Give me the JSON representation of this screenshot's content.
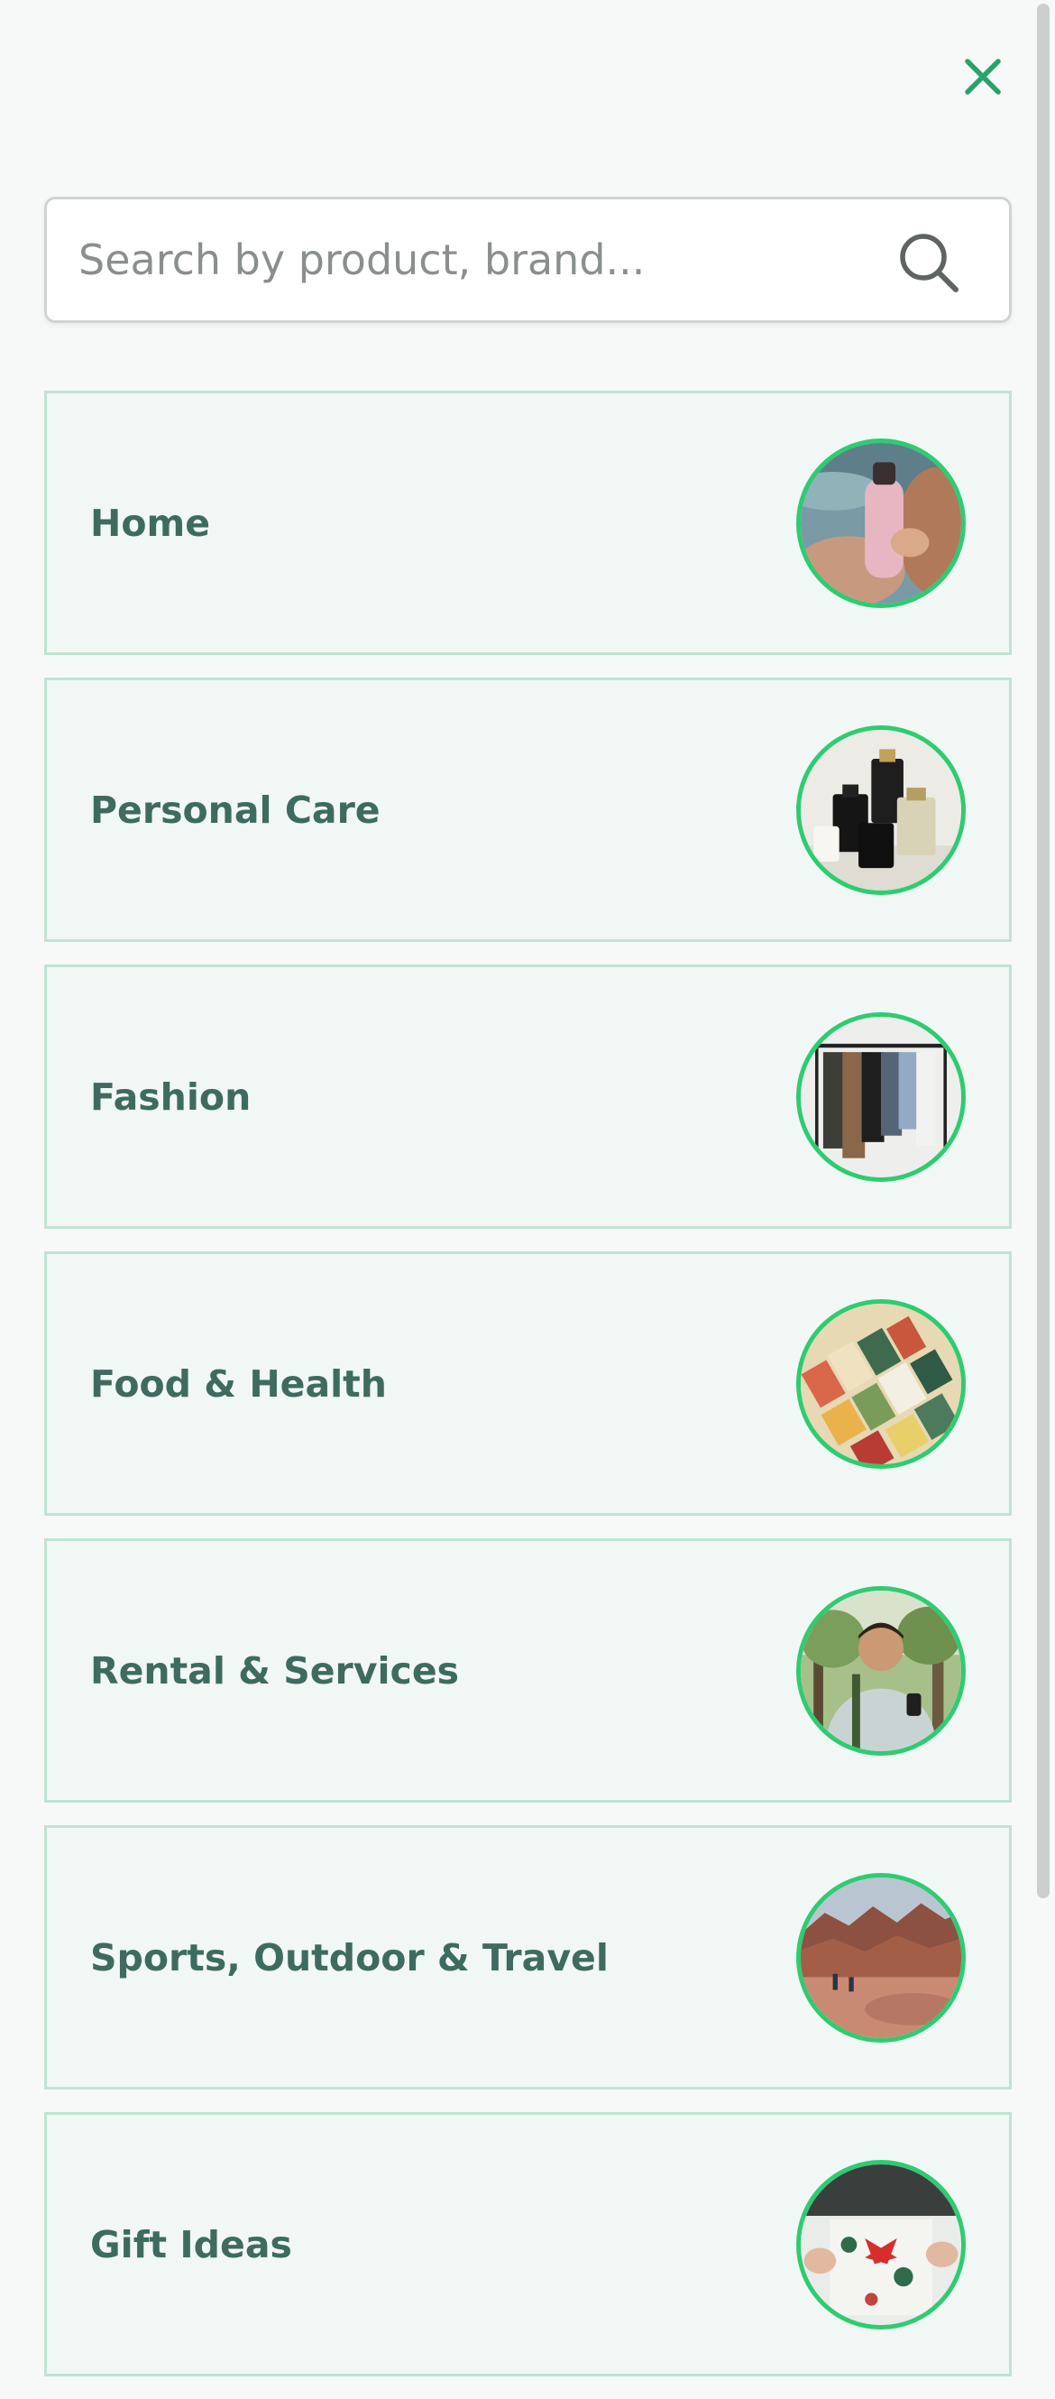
{
  "search": {
    "placeholder": "Search by product, brand..."
  },
  "categories": [
    {
      "label": "Home",
      "image": "pink-water-bottle-photo"
    },
    {
      "label": "Personal Care",
      "image": "perfume-bottles-photo"
    },
    {
      "label": "Fashion",
      "image": "clothing-rack-photo"
    },
    {
      "label": "Food & Health",
      "image": "food-boxes-photo"
    },
    {
      "label": "Rental & Services",
      "image": "man-with-phone-photo"
    },
    {
      "label": "Sports, Outdoor & Travel",
      "image": "canyon-hikers-photo"
    },
    {
      "label": "Gift Ideas",
      "image": "gift-wrapping-photo"
    }
  ],
  "colors": {
    "accent": "#2ecc71",
    "label_text": "#3e6b5f",
    "card_background": "#f1f7f5",
    "card_border": "#bfe4d3",
    "close_icon": "#27a36a"
  },
  "icons": {
    "close": "close-icon",
    "search": "search-icon"
  }
}
